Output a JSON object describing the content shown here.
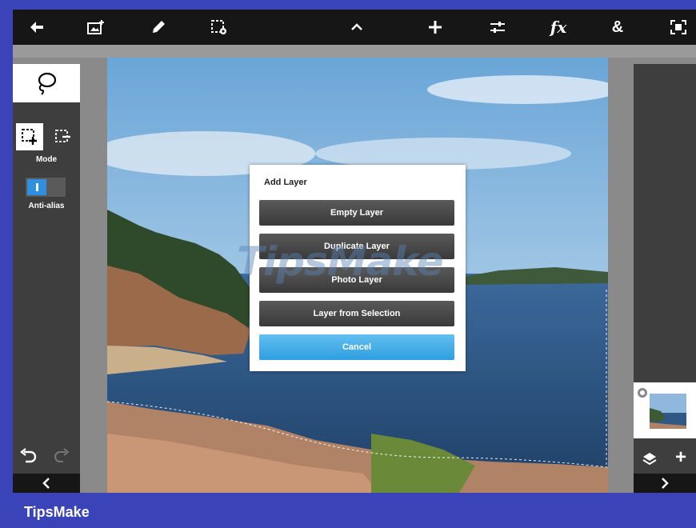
{
  "toolbar": {
    "items": [
      "back-arrow-icon",
      "add-image-icon",
      "pencil-icon",
      "selection-settings-icon",
      "chevron-up-icon",
      "plus-icon",
      "adjustments-icon",
      "effects-icon",
      "blend-icon",
      "fullscreen-icon"
    ],
    "fx_label": "fx",
    "amp_label": "&"
  },
  "left_panel": {
    "tool": "lasso-icon",
    "mode_label": "Mode",
    "antialias_label": "Anti-alias",
    "antialias_on": true
  },
  "dialog": {
    "title": "Add Layer",
    "buttons": [
      "Empty Layer",
      "Duplicate Layer",
      "Photo Layer",
      "Layer from Selection"
    ],
    "cancel_label": "Cancel"
  },
  "watermark": "TipsMake",
  "brand": "TipsMake",
  "colors": {
    "frame": "#3a44b8",
    "toolbar": "#161616",
    "panel": "#3e3e3e",
    "accent": "#2f9ee0"
  }
}
